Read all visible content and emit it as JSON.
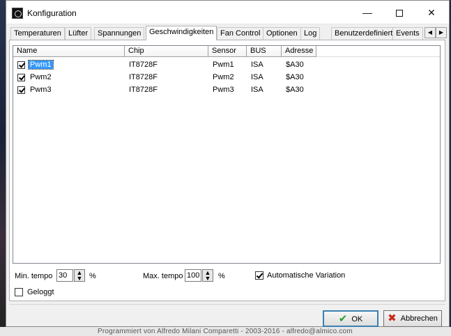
{
  "window": {
    "title": "Konfiguration"
  },
  "tabs": [
    {
      "label": "Temperaturen",
      "active": false
    },
    {
      "label": "Lüfter",
      "active": false
    },
    {
      "label": "Spannungen",
      "active": false
    },
    {
      "label": "Geschwindigkeiten",
      "active": true
    },
    {
      "label": "Fan Control",
      "active": false
    },
    {
      "label": "Optionen",
      "active": false
    },
    {
      "label": "Log",
      "active": false
    },
    {
      "label": "Benutzerdefiniert",
      "active": false
    },
    {
      "label": "Events",
      "active": false
    }
  ],
  "table": {
    "columns": [
      "Name",
      "Chip",
      "Sensor",
      "BUS",
      "Adresse"
    ],
    "rows": [
      {
        "checked": true,
        "name": "Pwm1",
        "chip": "IT8728F",
        "sensor": "Pwm1",
        "bus": "ISA",
        "address": "$A30",
        "selected": true
      },
      {
        "checked": true,
        "name": "Pwm2",
        "chip": "IT8728F",
        "sensor": "Pwm2",
        "bus": "ISA",
        "address": "$A30",
        "selected": false
      },
      {
        "checked": true,
        "name": "Pwm3",
        "chip": "IT8728F",
        "sensor": "Pwm3",
        "bus": "ISA",
        "address": "$A30",
        "selected": false
      }
    ]
  },
  "controls": {
    "min_label": "Min. tempo",
    "min_value": "30",
    "min_unit": "%",
    "max_label": "Max. tempo",
    "max_value": "100",
    "max_unit": "%",
    "auto_variation_label": "Automatische Variation",
    "auto_variation_checked": true,
    "logged_label": "Geloggt",
    "logged_checked": false
  },
  "buttons": {
    "ok": "OK",
    "cancel": "Abbrechen"
  },
  "icons": {
    "ok": "checkmark-icon",
    "cancel": "x-icon"
  },
  "background": {
    "footer_text": "Programmiert von Alfredo Milani Comparetti - 2003-2016 - alfredo@almico.com"
  }
}
